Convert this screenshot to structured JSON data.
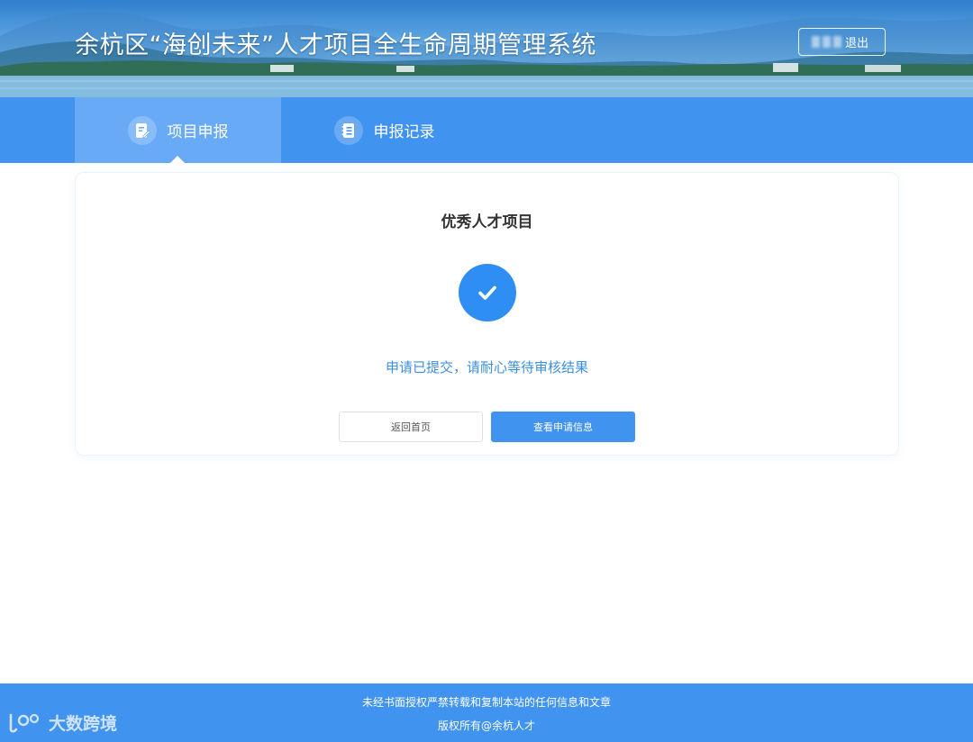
{
  "header": {
    "title": "余杭区“海创未来”人才项目全生命周期管理系统",
    "logout_label": "退出"
  },
  "nav": {
    "tabs": [
      {
        "label": "项目申报",
        "icon": "edit-document-icon",
        "active": true
      },
      {
        "label": "申报记录",
        "icon": "notebook-list-icon",
        "active": false
      }
    ]
  },
  "card": {
    "title": "优秀人才项目",
    "status_icon": "check-circle-icon",
    "status_text": "申请已提交，请耐心等待审核结果",
    "buttons": {
      "home_label": "返回首页",
      "view_label": "查看申请信息"
    }
  },
  "footer": {
    "notice": "未经书面授权严禁转载和复制本站的任何信息和文章",
    "copyright": "版权所有@余杭人才"
  },
  "watermark": {
    "text": "大数跨境"
  },
  "colors": {
    "primary": "#4193f0",
    "active_tab": "#68aaf6",
    "status_text": "#3d8fe0",
    "check_circle": "#2f8ef3"
  }
}
